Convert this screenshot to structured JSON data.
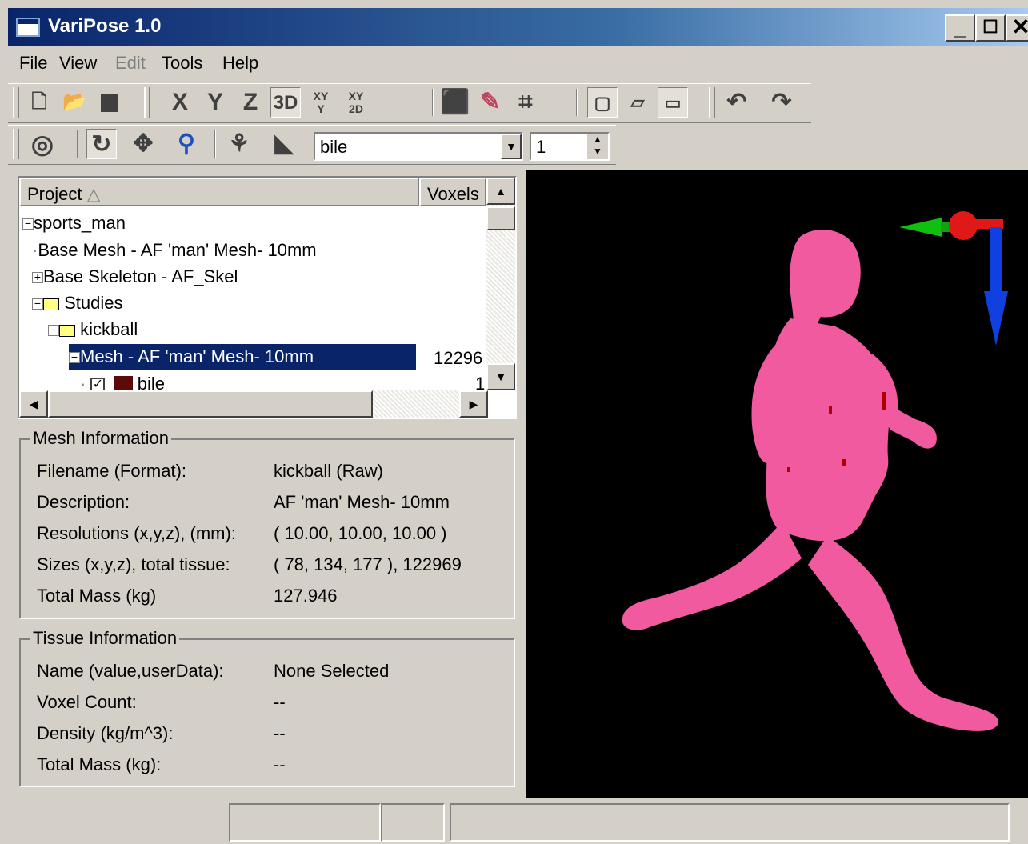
{
  "window": {
    "title": "VariPose 1.0"
  },
  "menu": [
    {
      "label": "File",
      "disabled": false
    },
    {
      "label": "View",
      "disabled": false
    },
    {
      "label": "Edit",
      "disabled": true
    },
    {
      "label": "Tools",
      "disabled": false
    },
    {
      "label": "Help",
      "disabled": false
    }
  ],
  "toolbar": {
    "axis_buttons": [
      "X",
      "Y",
      "Z",
      "3D"
    ],
    "tissue_select": "bile",
    "spin_value": "1"
  },
  "tree": {
    "col_project": "Project",
    "col_voxels": "Voxels",
    "rows": [
      {
        "label": "sports_man",
        "value": ""
      },
      {
        "label": "Base Mesh - AF 'man' Mesh- 10mm",
        "value": ""
      },
      {
        "label": "Base Skeleton - AF_Skel",
        "value": ""
      },
      {
        "label": "Studies",
        "value": ""
      },
      {
        "label": "kickball",
        "value": ""
      },
      {
        "label": "Mesh - AF 'man' Mesh- 10mm",
        "value": "12296"
      },
      {
        "label": "bile",
        "value": "1"
      }
    ]
  },
  "mesh_info": {
    "title": "Mesh Information",
    "rows": [
      {
        "label": "Filename (Format):",
        "value": "kickball (Raw)"
      },
      {
        "label": "Description:",
        "value": "AF 'man' Mesh- 10mm"
      },
      {
        "label": "Resolutions (x,y,z), (mm):",
        "value": "( 10.00, 10.00, 10.00 )"
      },
      {
        "label": "Sizes (x,y,z), total tissue:",
        "value": "( 78, 134, 177 ), 122969"
      },
      {
        "label": "Total Mass (kg)",
        "value": "127.946"
      }
    ]
  },
  "tissue_info": {
    "title": "Tissue Information",
    "rows": [
      {
        "label": "Name (value,userData):",
        "value": "None Selected"
      },
      {
        "label": "Voxel Count:",
        "value": "--"
      },
      {
        "label": "Density (kg/m^3):",
        "value": "--"
      },
      {
        "label": "Total Mass (kg):",
        "value": "--"
      }
    ]
  },
  "colors": {
    "titlebar": "#0a246a",
    "body_mesh": "#f25aa0",
    "tissue_swatch": "#5c0a0a",
    "selection": "#0a246a"
  }
}
